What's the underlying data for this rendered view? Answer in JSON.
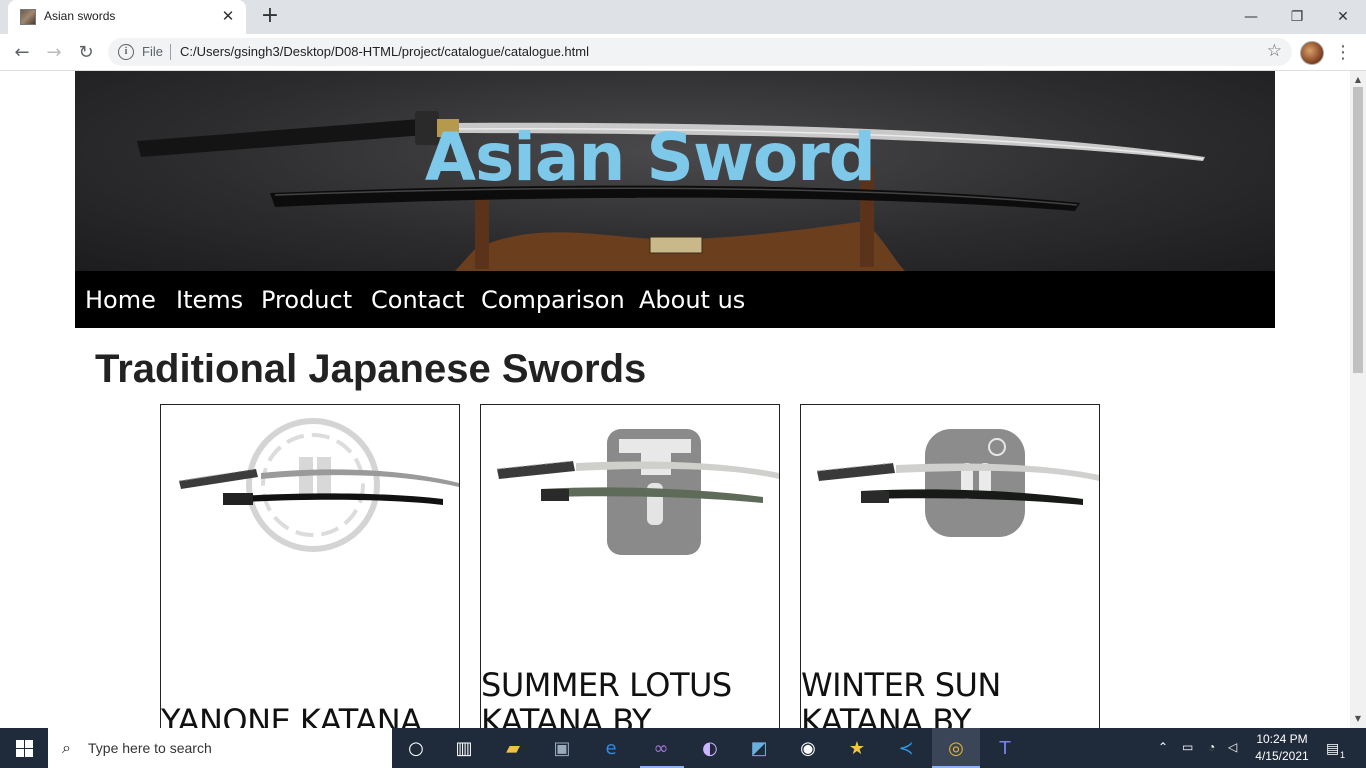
{
  "browser": {
    "tab_title": "Asian swords",
    "tab_close": "✕",
    "new_tab": "+",
    "window_controls": {
      "minimize": "—",
      "maximize": "❐",
      "close": "✕"
    },
    "back": "←",
    "forward": "→",
    "reload": "↻",
    "info": "i",
    "file_label": "File",
    "url": "C:/Users/gsingh3/Desktop/D08-HTML/project/catalogue/catalogue.html",
    "star": "☆",
    "menu": "⋮"
  },
  "page": {
    "banner_title": "Asian Sword",
    "nav": [
      "Home",
      "Items",
      "Product",
      "Contact",
      "Comparison",
      "About us"
    ],
    "section_title": "Traditional Japanese Swords",
    "products": [
      {
        "title": "YANONE KATANA",
        "tsuba": "round"
      },
      {
        "title": "SUMMER LOTUS KATANA BY",
        "tsuba": "square"
      },
      {
        "title": "WINTER SUN KATANA BY",
        "tsuba": "rounded-square"
      }
    ]
  },
  "taskbar": {
    "search_placeholder": "Type here to search",
    "time": "10:24 PM",
    "date": "4/15/2021",
    "notifications": "1"
  },
  "colors": {
    "title_accent": "#7ec8ea",
    "navbar_bg": "#000000",
    "taskbar_bg": "#1f2b3a"
  }
}
